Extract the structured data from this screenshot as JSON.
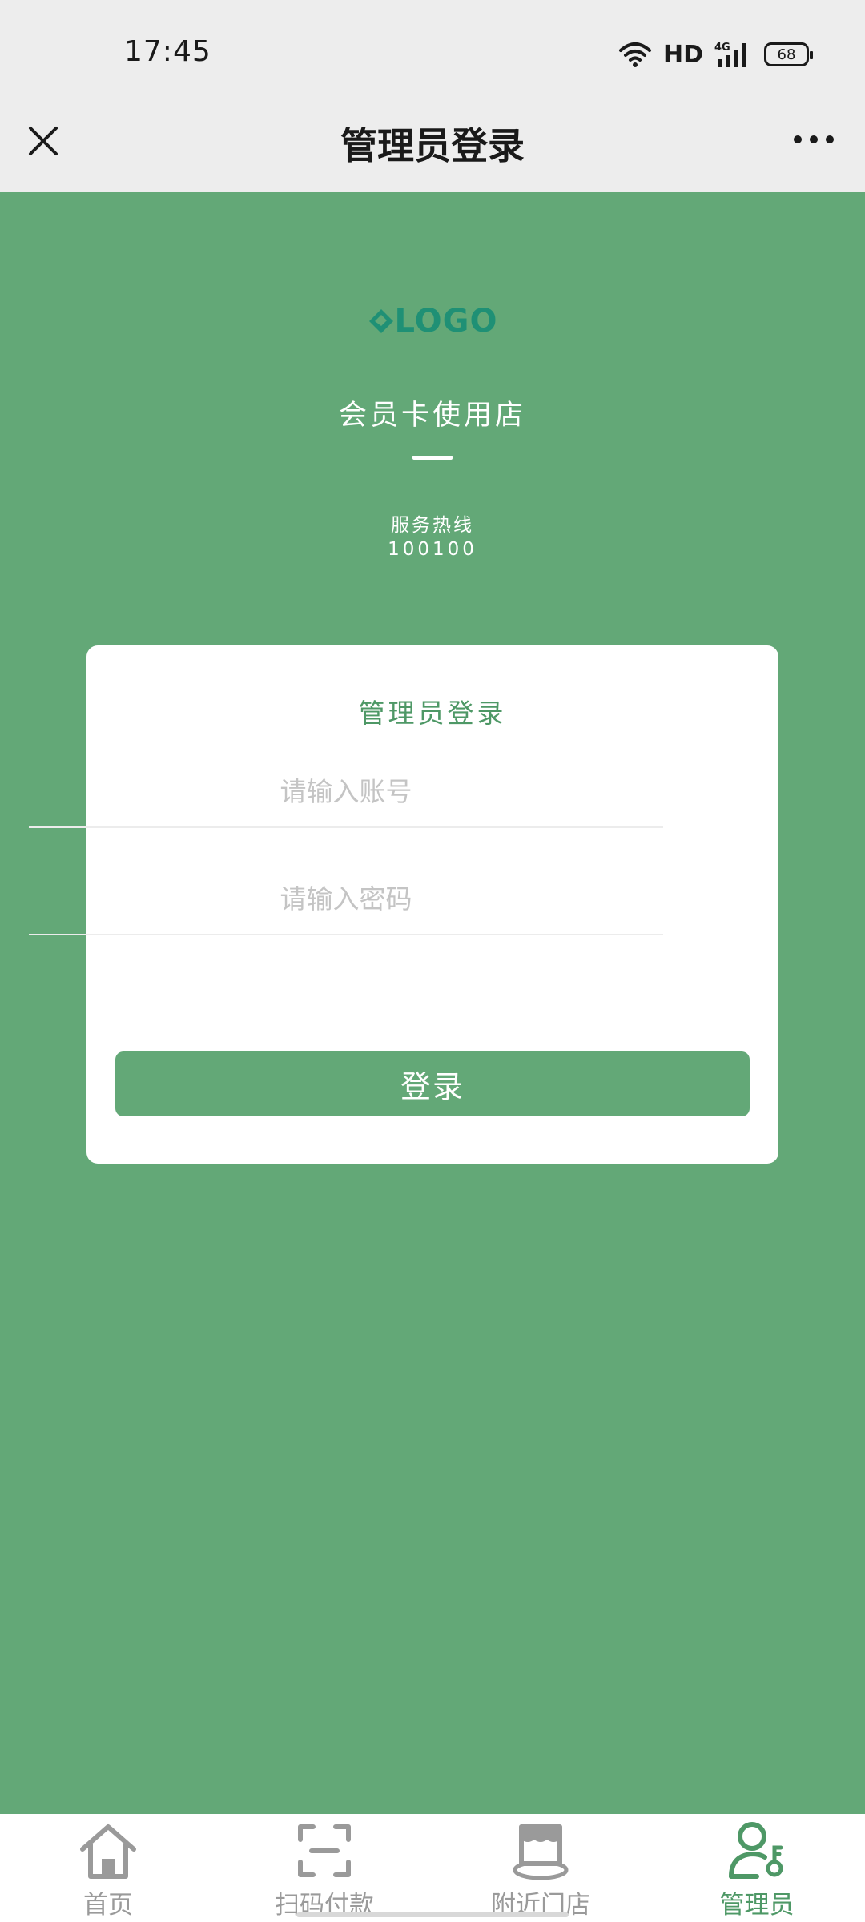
{
  "status_bar": {
    "time": "17:45",
    "network": "HD",
    "signal_label": "4G",
    "battery": "68"
  },
  "nav": {
    "title": "管理员登录",
    "close_icon": "close-icon",
    "more_icon": "more-icon"
  },
  "brand": {
    "logo_text": "LOGO",
    "shop_name": "会员卡使用店",
    "hotline_label": "服务热线",
    "hotline_number": "100100"
  },
  "login": {
    "title": "管理员登录",
    "account_placeholder": "请输入账号",
    "password_placeholder": "请输入密码",
    "button_label": "登录"
  },
  "tabs": [
    {
      "label": "首页",
      "icon": "home-icon",
      "active": false
    },
    {
      "label": "扫码付款",
      "icon": "scan-icon",
      "active": false
    },
    {
      "label": "附近门店",
      "icon": "store-icon",
      "active": false
    },
    {
      "label": "管理员",
      "icon": "admin-icon",
      "active": true
    }
  ],
  "colors": {
    "accent": "#63a877",
    "accent_dark": "#4e9866",
    "logo": "#1f9075",
    "inactive_tab": "#9a9a9a"
  }
}
